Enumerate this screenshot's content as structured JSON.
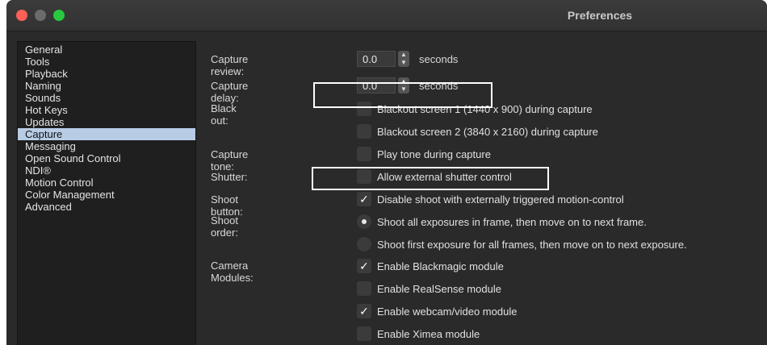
{
  "window": {
    "title": "Preferences"
  },
  "sidebar": {
    "items": [
      {
        "label": "General"
      },
      {
        "label": "Tools"
      },
      {
        "label": "Playback"
      },
      {
        "label": "Naming"
      },
      {
        "label": "Sounds"
      },
      {
        "label": "Hot Keys"
      },
      {
        "label": "Updates"
      },
      {
        "label": "Capture"
      },
      {
        "label": "Messaging"
      },
      {
        "label": "Open Sound Control"
      },
      {
        "label": "NDI®"
      },
      {
        "label": "Motion Control"
      },
      {
        "label": "Color Management"
      },
      {
        "label": "Advanced"
      }
    ],
    "selected": "Capture"
  },
  "capture": {
    "review": {
      "label": "Capture review:",
      "value": "0.0",
      "unit": "seconds"
    },
    "delay": {
      "label": "Capture delay:",
      "value": "0.0",
      "unit": "seconds"
    },
    "blackout": {
      "label": "Black out:",
      "options": [
        {
          "text": "Blackout screen 1 (1440 x 900) during capture",
          "checked": false
        },
        {
          "text": "Blackout screen 2 (3840 x 2160) during capture",
          "checked": false
        }
      ]
    },
    "tone": {
      "label": "Capture tone:",
      "text": "Play tone during capture",
      "checked": false
    },
    "shutter": {
      "label": "Shutter:",
      "text": "Allow external shutter control",
      "checked": false
    },
    "shoot_button": {
      "label": "Shoot button:",
      "text": "Disable shoot with externally triggered motion-control",
      "checked": true
    },
    "shoot_order": {
      "label": "Shoot order:",
      "options": [
        {
          "text": "Shoot all exposures in frame, then move on to next frame.",
          "selected": true
        },
        {
          "text": "Shoot first exposure for all frames, then move on to next exposure.",
          "selected": false
        }
      ]
    },
    "camera_modules": {
      "label": "Camera Modules:",
      "options": [
        {
          "text": "Enable Blackmagic module",
          "checked": true
        },
        {
          "text": "Enable RealSense module",
          "checked": false
        },
        {
          "text": "Enable webcam/video module",
          "checked": true
        },
        {
          "text": "Enable Ximea module",
          "checked": false
        }
      ]
    }
  },
  "glyphs": {
    "check": "✓",
    "stepper_up": "▲",
    "stepper_down": "▼"
  },
  "colors": {
    "selection": "#b8cce6",
    "close": "#fe5f57",
    "maximize": "#28c840"
  }
}
